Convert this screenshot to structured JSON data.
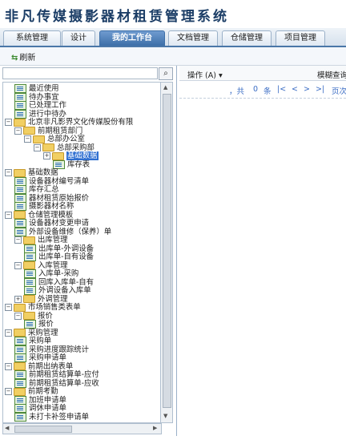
{
  "app": {
    "title": "非凡传媒摄影器材租赁管理系统"
  },
  "tabs": [
    "系统管理",
    "设计",
    "我的工作台",
    "文档管理",
    "仓储管理",
    "项目管理"
  ],
  "active_tab": "我的工作台",
  "toolbar": {
    "refresh_label": "刷新"
  },
  "search": {
    "value": ""
  },
  "tree": [
    {
      "label": "最近使用",
      "type": "doc"
    },
    {
      "label": "待办事宜",
      "type": "doc"
    },
    {
      "label": "已处理工作",
      "type": "doc"
    },
    {
      "label": "进行中待办",
      "type": "doc"
    },
    {
      "label": "北京非凡影界文化传媒股份有限",
      "type": "folder",
      "expanded": true
    },
    {
      "label": "前期租赁部门",
      "type": "folder",
      "expanded": true
    },
    {
      "label": "总部办公室",
      "type": "folder",
      "expanded": true
    },
    {
      "label": "总部采购部",
      "type": "folder",
      "expanded": true
    },
    {
      "label": "基础数据",
      "type": "folder",
      "selected": true
    },
    {
      "label": "库存表",
      "type": "doc"
    },
    {
      "label": "基础数据",
      "type": "folder",
      "expanded": true
    },
    {
      "label": "设备器材编号清单",
      "type": "doc"
    },
    {
      "label": "库存汇总",
      "type": "doc"
    },
    {
      "label": "器材租赁原始报价",
      "type": "doc"
    },
    {
      "label": "摄影器材名称",
      "type": "doc"
    },
    {
      "label": "仓储管理模板",
      "type": "folder",
      "expanded": true
    },
    {
      "label": "设备器材变更申请",
      "type": "doc"
    },
    {
      "label": "外部设备维修（保养）单",
      "type": "doc"
    },
    {
      "label": "出库管理",
      "type": "folder",
      "expanded": true
    },
    {
      "label": "出库单-外调设备",
      "type": "doc"
    },
    {
      "label": "出库单-自有设备",
      "type": "doc"
    },
    {
      "label": "入库管理",
      "type": "folder",
      "expanded": true
    },
    {
      "label": "入库单-采购",
      "type": "doc"
    },
    {
      "label": "回库入库单-自有",
      "type": "doc"
    },
    {
      "label": "外调设备入库单",
      "type": "doc"
    },
    {
      "label": "外调管理",
      "type": "folder",
      "expanded": false
    },
    {
      "label": "市场销售类表单",
      "type": "folder",
      "expanded": true
    },
    {
      "label": "报价",
      "type": "folder",
      "expanded": true
    },
    {
      "label": "报价",
      "type": "doc"
    },
    {
      "label": "采购管理",
      "type": "folder",
      "expanded": true
    },
    {
      "label": "采购单",
      "type": "doc"
    },
    {
      "label": "采购进度跟踪统计",
      "type": "doc"
    },
    {
      "label": "采购申请单",
      "type": "doc"
    },
    {
      "label": "前期出纳表单",
      "type": "folder",
      "expanded": true
    },
    {
      "label": "前期租赁结算单-应付",
      "type": "doc"
    },
    {
      "label": "前期租赁结算单-应收",
      "type": "doc"
    },
    {
      "label": "前期考勤",
      "type": "folder",
      "expanded": true
    },
    {
      "label": "加班申请单",
      "type": "doc"
    },
    {
      "label": "调休申请单",
      "type": "doc"
    },
    {
      "label": "未打卡补签申请单",
      "type": "doc"
    }
  ],
  "right": {
    "op_label": "操作 (A)",
    "fuzzy_label": "模糊查询",
    "pager": {
      "prefix": "，共",
      "count": "0",
      "unit": "条",
      "first": "|<",
      "prev": "<",
      "next": ">",
      "last": ">|",
      "page": "页次"
    }
  },
  "colors": {
    "accent": "#3d6fa8",
    "selected": "#2f6fd1"
  }
}
